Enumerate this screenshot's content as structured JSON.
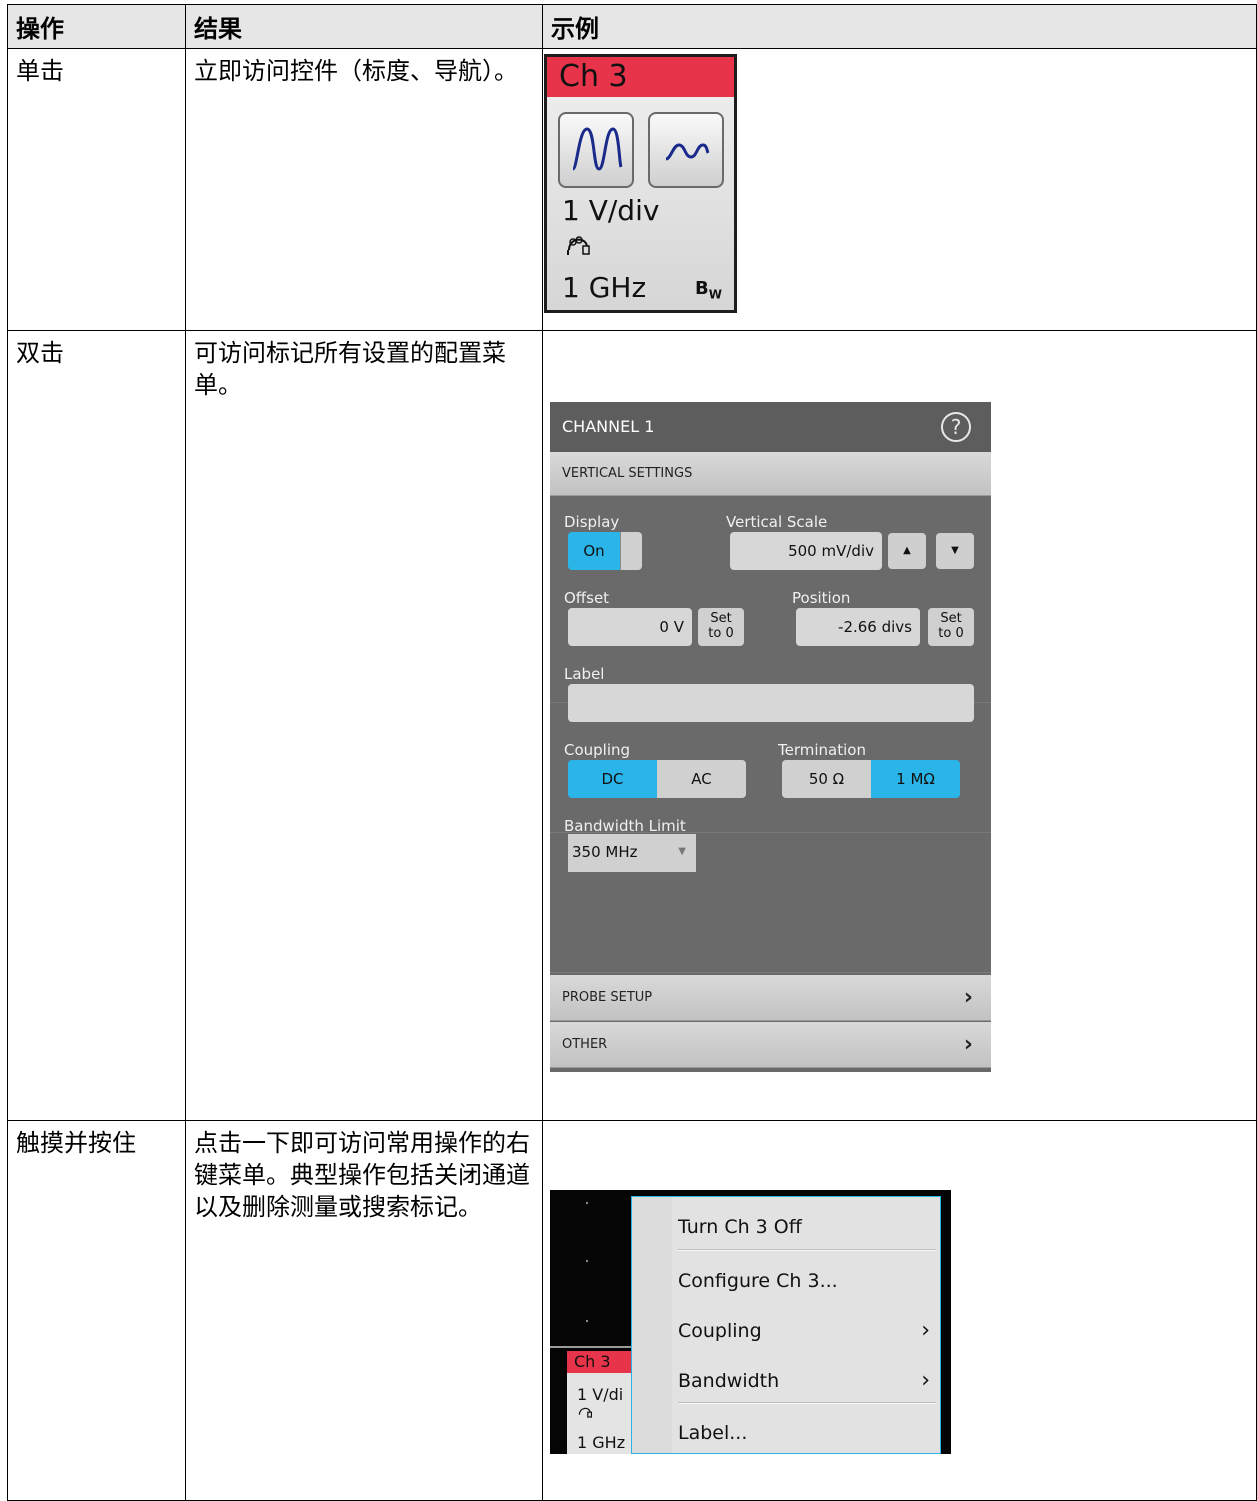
{
  "table": {
    "headers": {
      "action": "操作",
      "result": "结果",
      "example": "示例"
    },
    "rows": [
      {
        "action": "单击",
        "result": "立即访问控件（标度、导航）。"
      },
      {
        "action": "双击",
        "result": "可访问标记所有设置的配置菜单。"
      },
      {
        "action": "触摸并按住",
        "result": "点击一下即可访问常用操作的右键菜单。典型操作包括关闭通道以及删除测量或搜索标记。"
      }
    ]
  },
  "badge": {
    "title": "Ch 3",
    "scale": "1 V/div",
    "bandwidth": "1 GHz",
    "bw_icon": "B",
    "bw_icon_sub": "W",
    "header_color": "#e8344a"
  },
  "config_menu": {
    "title": "CHANNEL 1",
    "help_icon": "?",
    "section_vertical": "VERTICAL SETTINGS",
    "display_label": "Display",
    "display_value": "On",
    "vscale_label": "Vertical Scale",
    "vscale_value": "500 mV/div",
    "offset_label": "Offset",
    "offset_value": "0 V",
    "set_to_zero_line1": "Set",
    "set_to_zero_line2": "to 0",
    "position_label": "Position",
    "position_value": "-2.66 divs",
    "label_label": "Label",
    "label_value": "",
    "coupling_label": "Coupling",
    "coupling_options": [
      "DC",
      "AC"
    ],
    "coupling_selected": "DC",
    "termination_label": "Termination",
    "termination_options": [
      "50 Ω",
      "1 MΩ"
    ],
    "termination_selected": "1 MΩ",
    "bandwidth_label": "Bandwidth Limit",
    "bandwidth_value": "350 MHz",
    "section_probe": "PROBE SETUP",
    "section_other": "OTHER",
    "accent_color": "#2ab4e8"
  },
  "context_menu": {
    "badge_title": "Ch 3",
    "badge_scale": "1 V/di",
    "badge_bw": "1 GHz",
    "items": [
      {
        "label": "Turn Ch 3 Off",
        "submenu": false
      },
      {
        "label": "Configure Ch 3...",
        "submenu": false
      },
      {
        "label": "Coupling",
        "submenu": true
      },
      {
        "label": "Bandwidth",
        "submenu": true
      },
      {
        "label": "Label...",
        "submenu": false
      }
    ],
    "chevron": "›"
  }
}
